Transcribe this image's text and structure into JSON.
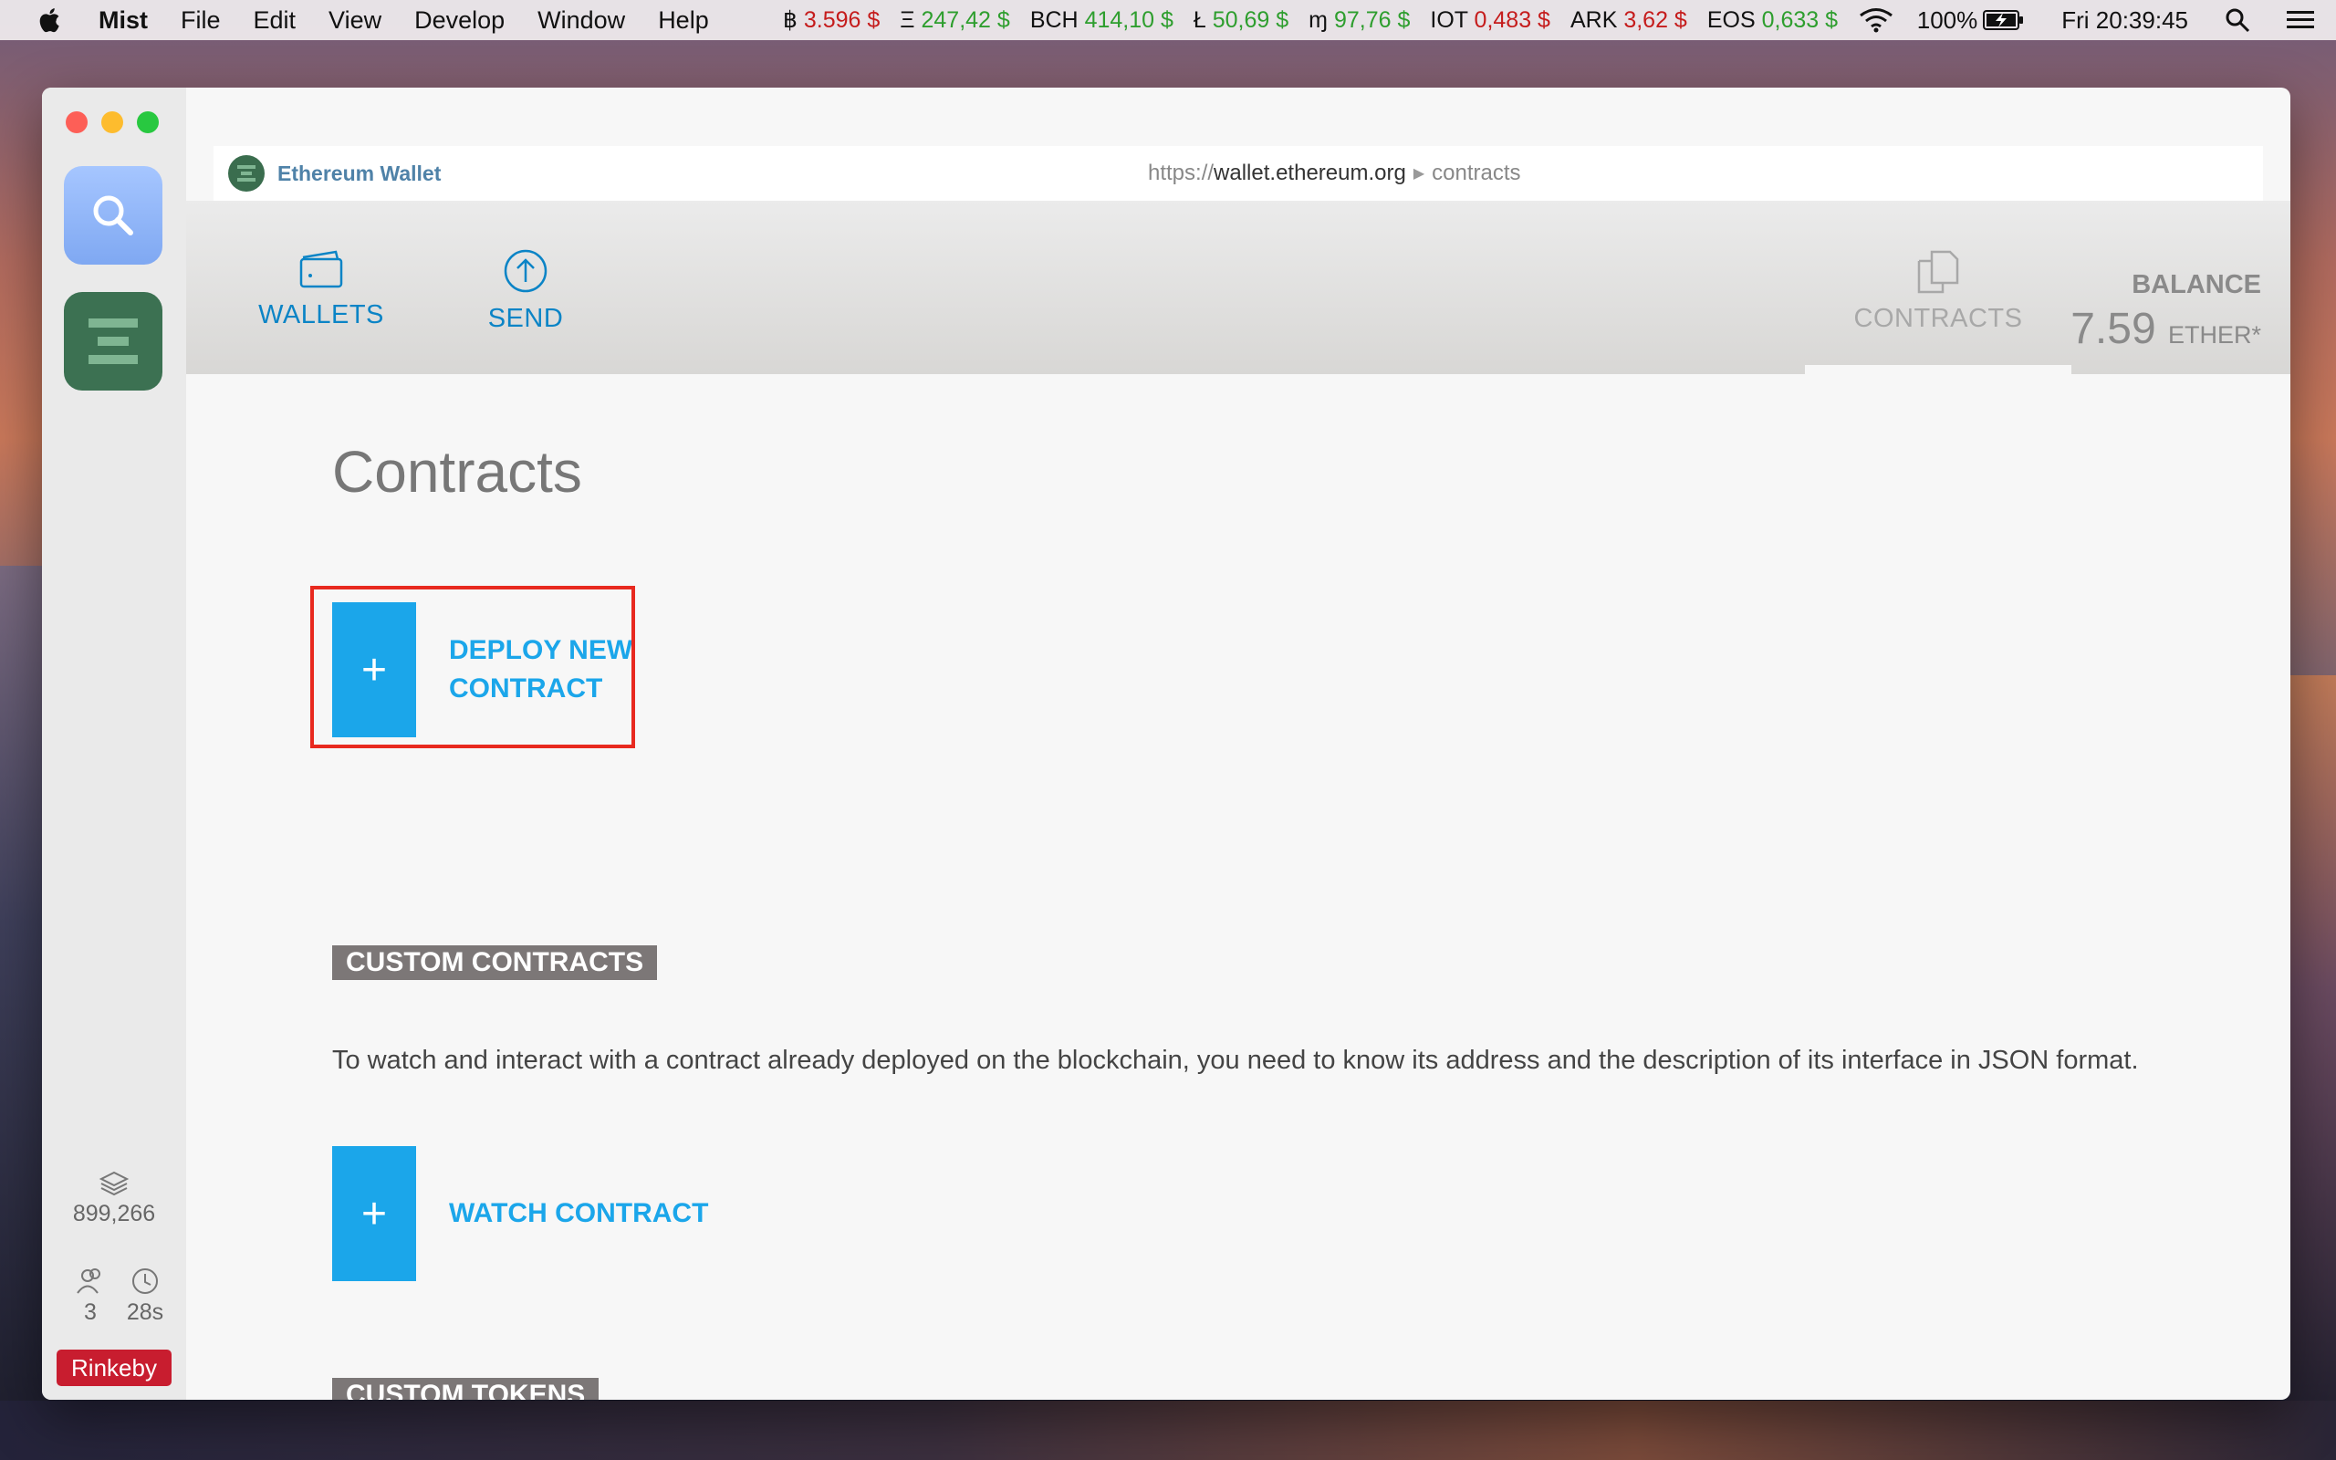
{
  "menubar": {
    "app": "Mist",
    "items": [
      "File",
      "Edit",
      "View",
      "Develop",
      "Window",
      "Help"
    ],
    "tickers": [
      {
        "symbol": "฿",
        "value": "3.596 $",
        "trend": "down"
      },
      {
        "symbol": "Ξ",
        "value": "247,42 $",
        "trend": "up"
      },
      {
        "symbol": "BCH",
        "value": "414,10 $",
        "trend": "up"
      },
      {
        "symbol": "Ł",
        "value": "50,69 $",
        "trend": "up"
      },
      {
        "symbol": "ɱ",
        "value": "97,76 $",
        "trend": "up"
      },
      {
        "symbol": "IOT",
        "value": "0,483 $",
        "trend": "down"
      },
      {
        "symbol": "ARK",
        "value": "3,62 $",
        "trend": "down"
      },
      {
        "symbol": "EOS",
        "value": "0,633 $",
        "trend": "up"
      }
    ],
    "battery": "100%",
    "clock": "Fri 20:39:45"
  },
  "sidebar": {
    "block_number": "899,266",
    "peers": "3",
    "last_block_time": "28s",
    "network": "Rinkeby"
  },
  "urlbar": {
    "title": "Ethereum Wallet",
    "protocol": "https://",
    "host": "wallet.ethereum.org",
    "path": "contracts"
  },
  "header": {
    "nav": {
      "wallets": "WALLETS",
      "send": "SEND",
      "contracts": "CONTRACTS"
    },
    "balance_label": "BALANCE",
    "balance_value": "7.59",
    "balance_unit": "ETHER*"
  },
  "main": {
    "title": "Contracts",
    "deploy_line1": "DEPLOY NEW",
    "deploy_line2": "CONTRACT",
    "plus": "+",
    "custom_contracts_heading": "CUSTOM CONTRACTS",
    "custom_contracts_desc": "To watch and interact with a contract already deployed on the blockchain, you need to know its address and the description of its interface in JSON format.",
    "watch_label": "WATCH CONTRACT",
    "custom_tokens_heading": "CUSTOM TOKENS"
  },
  "colors": {
    "accent": "#1ba6ea",
    "nav_blue": "#0b84c6",
    "network_badge": "#c81d2f",
    "highlight": "#e8291f"
  }
}
